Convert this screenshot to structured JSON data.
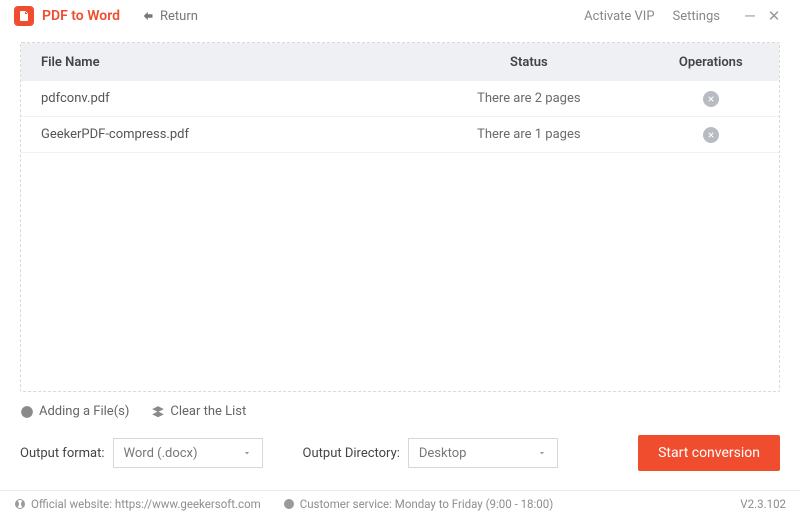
{
  "header": {
    "title": "PDF to Word",
    "return_label": "Return",
    "activate_label": "Activate VIP",
    "settings_label": "Settings"
  },
  "table": {
    "headers": {
      "file": "File Name",
      "status": "Status",
      "operations": "Operations"
    },
    "rows": [
      {
        "file": "pdfconv.pdf",
        "status": "There are 2 pages"
      },
      {
        "file": "GeekerPDF-compress.pdf",
        "status": "There are 1 pages"
      }
    ]
  },
  "actions": {
    "add_label": "Adding a File(s)",
    "clear_label": "Clear the List"
  },
  "output": {
    "format_label": "Output format:",
    "format_value": "Word (.docx)",
    "dir_label": "Output Directory:",
    "dir_value": "Desktop",
    "start_label": "Start conversion"
  },
  "footer": {
    "website_label": "Official website: https://www.geekersoft.com",
    "service_label": "Customer service: Monday to Friday (9:00 - 18:00)",
    "version": "V2.3.102"
  }
}
